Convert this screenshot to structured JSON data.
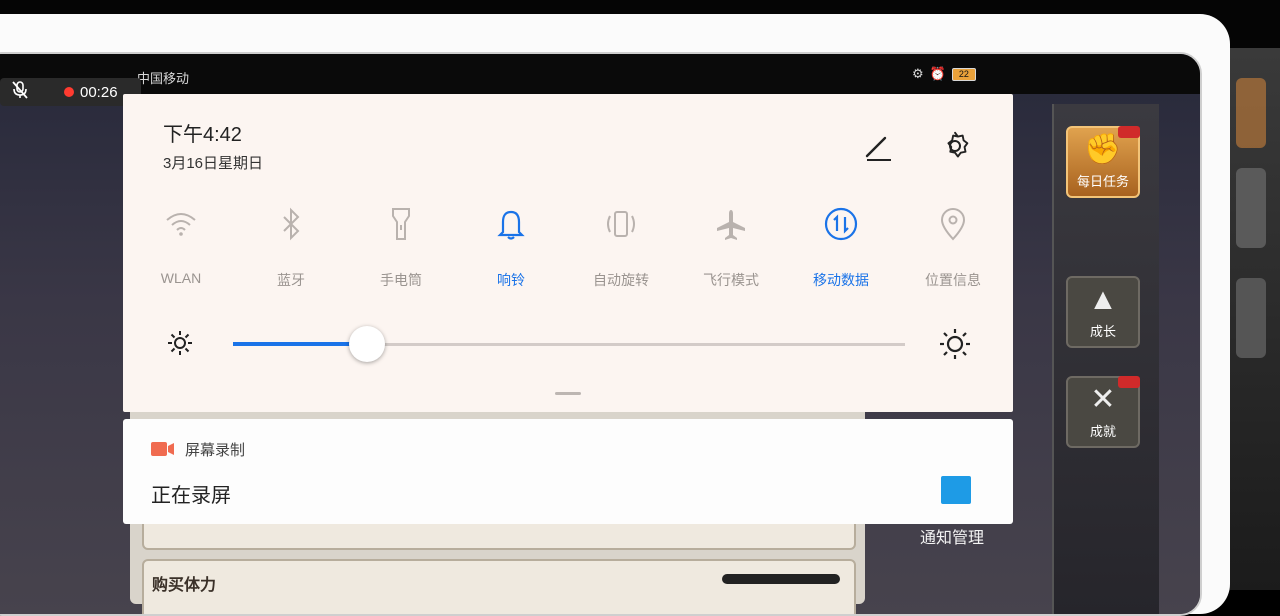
{
  "status_bar": {
    "carrier": "中国移动",
    "battery": "22"
  },
  "recording_indicator": {
    "elapsed": "00:26"
  },
  "quick_settings": {
    "time": "下午4:42",
    "date": "3月16日星期日",
    "toggles": [
      {
        "label": "WLAN",
        "icon": "wifi-icon",
        "active": false
      },
      {
        "label": "蓝牙",
        "icon": "bluetooth-icon",
        "active": false
      },
      {
        "label": "手电筒",
        "icon": "flashlight-icon",
        "active": false
      },
      {
        "label": "响铃",
        "icon": "bell-icon",
        "active": true
      },
      {
        "label": "自动旋转",
        "icon": "auto-rotate-icon",
        "active": false
      },
      {
        "label": "飞行模式",
        "icon": "airplane-icon",
        "active": false
      },
      {
        "label": "移动数据",
        "icon": "mobile-data-icon",
        "active": true
      },
      {
        "label": "位置信息",
        "icon": "location-icon",
        "active": false
      }
    ],
    "brightness": 0.2,
    "accent_color": "#1a73e8"
  },
  "recording_notification": {
    "app_name": "屏幕录制",
    "status": "正在录屏",
    "stop_color": "#1e9be6"
  },
  "game": {
    "side_buttons": [
      {
        "label": "每日任务",
        "icon": "fist-icon"
      },
      {
        "label": "成长",
        "icon": "tree-icon"
      },
      {
        "label": "成就",
        "icon": "swords-icon"
      }
    ],
    "notification_management": "通知管理",
    "buy_stamina": "购买体力"
  }
}
